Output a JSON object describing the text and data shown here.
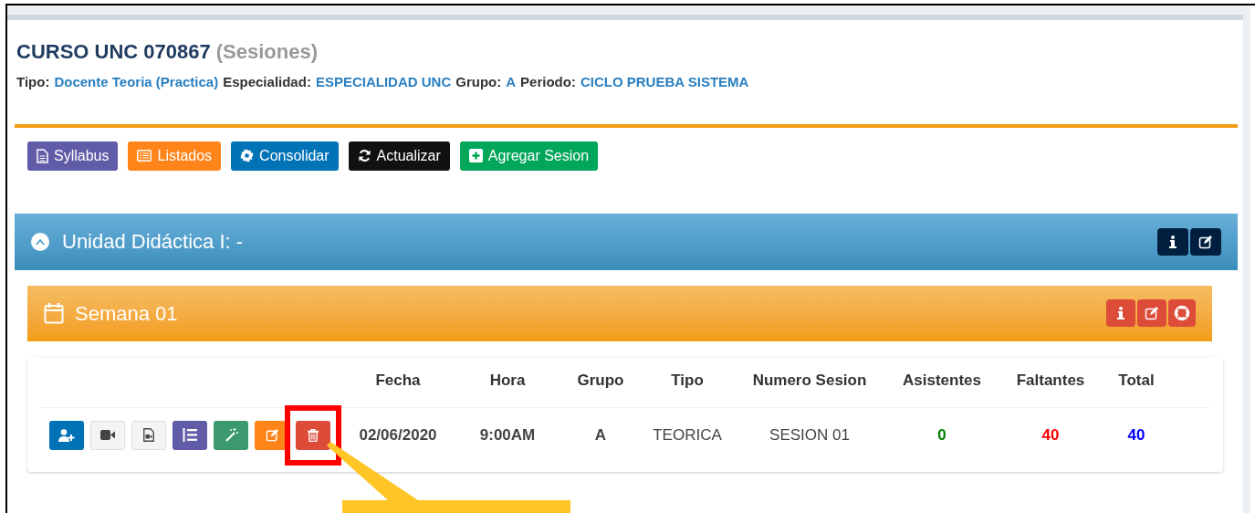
{
  "course": {
    "title": "CURSO UNC 070867",
    "subtitle": "(Sesiones)"
  },
  "meta": [
    {
      "label": "Tipo:",
      "value": "Docente Teoria (Practica)"
    },
    {
      "label": "Especialidad:",
      "value": "ESPECIALIDAD UNC"
    },
    {
      "label": "Grupo:",
      "value": "A"
    },
    {
      "label": "Periodo:",
      "value": "CICLO PRUEBA SISTEMA"
    }
  ],
  "toolbar": [
    {
      "label": "Syllabus",
      "color": "#605ca8"
    },
    {
      "label": "Listados",
      "color": "#ff851b"
    },
    {
      "label": "Consolidar",
      "color": "#0073b7"
    },
    {
      "label": "Actualizar",
      "color": "#111111"
    },
    {
      "label": "Agregar Sesion",
      "color": "#00a65a"
    }
  ],
  "unit": {
    "title": "Unidad Didáctica I: -"
  },
  "week": {
    "title": "Semana 01"
  },
  "table": {
    "columns": [
      "Fecha",
      "Hora",
      "Grupo",
      "Tipo",
      "Numero Sesion",
      "Asistentes",
      "Faltantes",
      "Total"
    ],
    "rows": [
      {
        "cells": [
          {
            "text": "02/06/2020",
            "bold": true
          },
          {
            "text": "9:00AM",
            "bold": true
          },
          {
            "text": "A",
            "bold": true
          },
          {
            "text": "TEORICA",
            "bold": false
          },
          {
            "text": "SESION 01",
            "bold": false
          },
          {
            "text": "0",
            "bold": true,
            "color": "#008000"
          },
          {
            "text": "40",
            "bold": true,
            "color": "#ff0000"
          },
          {
            "text": "40",
            "bold": true,
            "color": "#0000ff"
          }
        ],
        "actions": [
          {
            "color": "#0073b7"
          },
          {
            "color": "#f4f4f4"
          },
          {
            "color": "#f4f4f4"
          },
          {
            "color": "#605ca8"
          },
          {
            "color": "#3d9970"
          },
          {
            "color": "#ff851b"
          },
          {
            "color": "#dd4b39",
            "highlighted": true
          }
        ]
      }
    ]
  }
}
